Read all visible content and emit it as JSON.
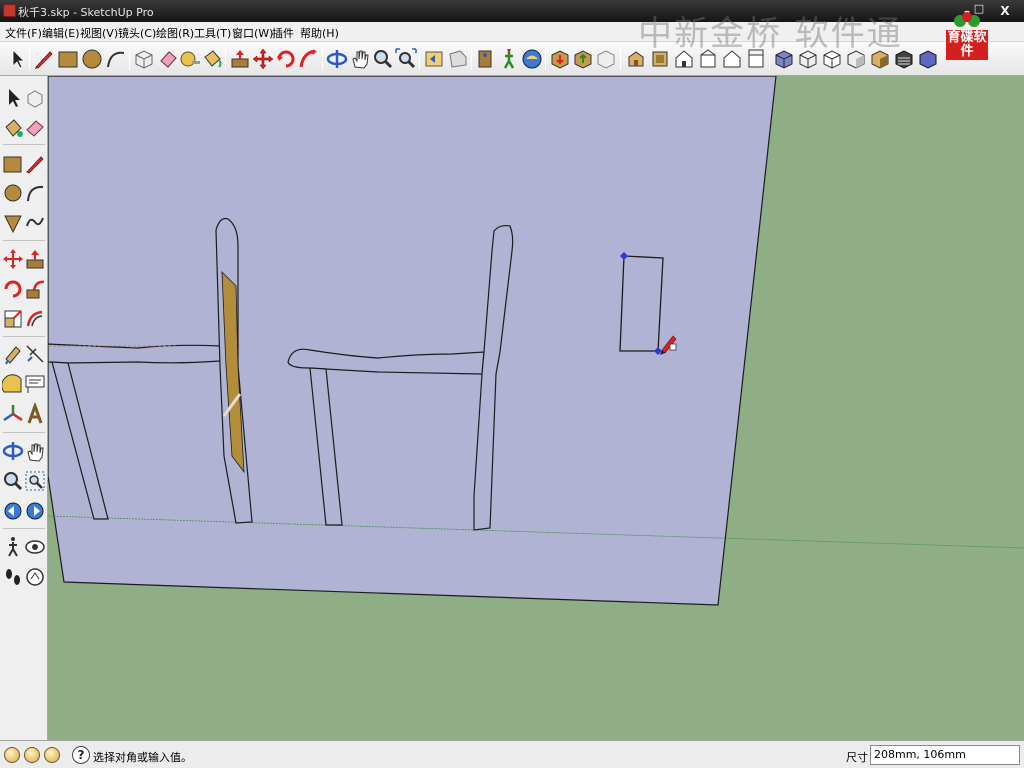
{
  "window": {
    "title": "秋千3.skp - SketchUp Pro",
    "controls": {
      "minimize": "–",
      "maximize": "□",
      "close": "X"
    }
  },
  "menubar": {
    "items": [
      {
        "label": "文件(F)"
      },
      {
        "label": "编辑(E)"
      },
      {
        "label": "视图(V)"
      },
      {
        "label": "镜头(C)"
      },
      {
        "label": "绘图(R)"
      },
      {
        "label": "工具(T)"
      },
      {
        "label": "窗口(W)"
      },
      {
        "label": "插件"
      },
      {
        "label": "帮助(H)"
      }
    ]
  },
  "watermark": {
    "text": "中新金桥 软件通"
  },
  "brand_logo": {
    "text": "育碟软件"
  },
  "statusbar": {
    "message": "选择对角或输入值。",
    "measure_label": "尺寸",
    "measure_value": "208mm, 106mm"
  },
  "colors": {
    "sky_plane": "#b0b3d3",
    "ground": "#8fae86",
    "wood_face": "#b28d3a",
    "edge": "#1c1c1c",
    "selection_vertex": "#2a3bd6"
  }
}
